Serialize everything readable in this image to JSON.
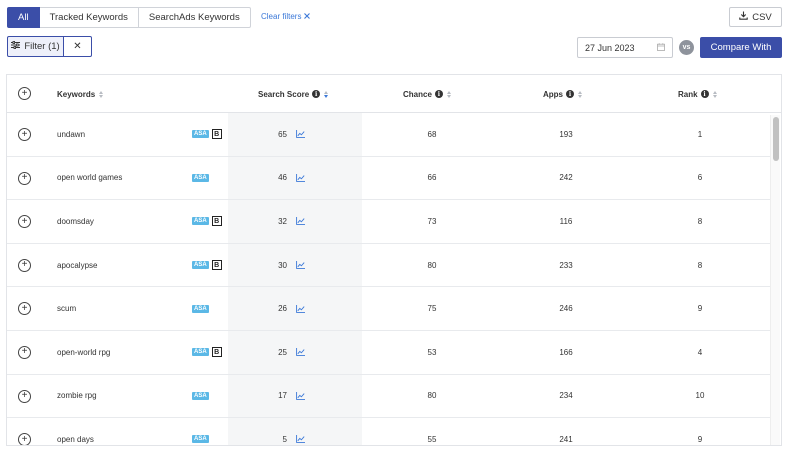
{
  "tabs": [
    {
      "label": "All",
      "active": true
    },
    {
      "label": "Tracked Keywords",
      "active": false
    },
    {
      "label": "SearchAds Keywords",
      "active": false
    }
  ],
  "clear_filters": {
    "label": "Clear filters",
    "icon": "close-icon"
  },
  "csv_button": {
    "label": "CSV",
    "icon": "download-icon"
  },
  "filter": {
    "label": "Filter (1)",
    "icon": "sliders-icon",
    "remove_symbol": "✕"
  },
  "date": {
    "value": "27 Jun 2023",
    "icon": "calendar-icon"
  },
  "vs_label": "vs",
  "compare_button": {
    "label": "Compare With"
  },
  "colors": {
    "accent": "#3b4ea8",
    "link": "#3b78d8",
    "asa_badge": "#5bb8e6"
  },
  "table": {
    "headers": {
      "keywords": "Keywords",
      "search_score": "Search Score",
      "chance": "Chance",
      "apps": "Apps",
      "rank": "Rank"
    },
    "sorted_column": "search_score",
    "sort_direction": "desc",
    "rows": [
      {
        "keyword": "undawn",
        "asa": "ASA",
        "b": "B",
        "search_score": "65",
        "chance": "68",
        "apps": "193",
        "rank": "1"
      },
      {
        "keyword": "open world games",
        "asa": "ASA",
        "b": "",
        "search_score": "46",
        "chance": "66",
        "apps": "242",
        "rank": "6"
      },
      {
        "keyword": "doomsday",
        "asa": "ASA",
        "b": "B",
        "search_score": "32",
        "chance": "73",
        "apps": "116",
        "rank": "8"
      },
      {
        "keyword": "apocalypse",
        "asa": "ASA",
        "b": "B",
        "search_score": "30",
        "chance": "80",
        "apps": "233",
        "rank": "8"
      },
      {
        "keyword": "scum",
        "asa": "ASA",
        "b": "",
        "search_score": "26",
        "chance": "75",
        "apps": "246",
        "rank": "9"
      },
      {
        "keyword": "open-world rpg",
        "asa": "ASA",
        "b": "B",
        "search_score": "25",
        "chance": "53",
        "apps": "166",
        "rank": "4"
      },
      {
        "keyword": "zombie rpg",
        "asa": "ASA",
        "b": "",
        "search_score": "17",
        "chance": "80",
        "apps": "234",
        "rank": "10"
      },
      {
        "keyword": "open days",
        "asa": "ASA",
        "b": "",
        "search_score": "5",
        "chance": "55",
        "apps": "241",
        "rank": "9"
      }
    ]
  }
}
